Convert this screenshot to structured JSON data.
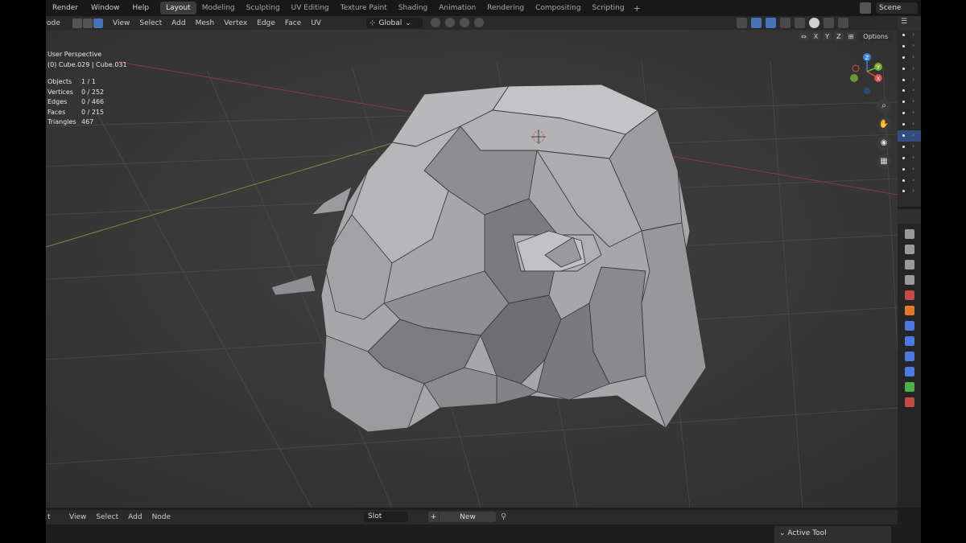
{
  "topbar": {
    "menus": [
      "Render",
      "Window",
      "Help"
    ],
    "tabs": [
      "Layout",
      "Modeling",
      "Sculpting",
      "UV Editing",
      "Texture Paint",
      "Shading",
      "Animation",
      "Rendering",
      "Compositing",
      "Scripting"
    ],
    "active_tab": "Layout",
    "add_workspace": "+",
    "scene_name": "Scene"
  },
  "viewport_header": {
    "mode_label": "ode",
    "menus": [
      "View",
      "Select",
      "Add",
      "Mesh",
      "Vertex",
      "Edge",
      "Face",
      "UV"
    ],
    "orientation": "Global",
    "orientation_icon": "global-transform-icon"
  },
  "viewport": {
    "view_name": "User Perspective",
    "object_name": "(0) Cube.029 | Cube.031",
    "stats": [
      {
        "label": "Objects",
        "value": "1 / 1"
      },
      {
        "label": "Vertices",
        "value": "0 / 252"
      },
      {
        "label": "Edges",
        "value": "0 / 466"
      },
      {
        "label": "Faces",
        "value": "0 / 215"
      },
      {
        "label": "Triangles",
        "value": "467"
      }
    ],
    "mirror_axes": [
      "X",
      "Y",
      "Z"
    ],
    "options_label": "Options",
    "gizmo_labels": {
      "x": "X",
      "y": "Y",
      "z": "Z"
    },
    "colors": {
      "x_axis": "#e04a4a",
      "y_axis": "#7ab032",
      "z_axis": "#3d80e0",
      "mesh": "#a8a8ab",
      "background": "#3a3a3a"
    }
  },
  "bottom_header": {
    "mode_label": "t",
    "menus": [
      "View",
      "Select",
      "Add",
      "Node"
    ],
    "slot": "Slot",
    "new_label": "New",
    "active_tool_label": "Active Tool"
  }
}
